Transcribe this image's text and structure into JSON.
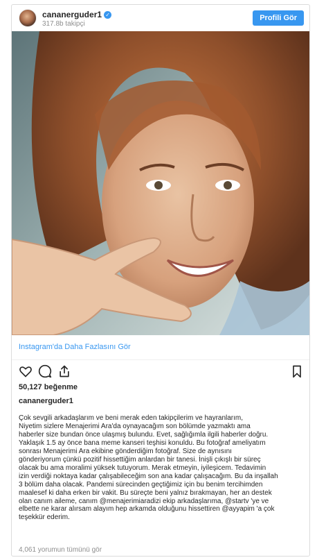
{
  "header": {
    "username": "cananerguder1",
    "verified_mark": "✓",
    "followers": "317.8b takipçi",
    "profile_button": "Profili Gör"
  },
  "post": {
    "image_icon": "photo-selfie",
    "more_link": "Instagram'da Daha Fazlasını Gör",
    "icons": [
      "heart-icon",
      "comment-icon",
      "share-icon",
      "bookmark-icon"
    ],
    "likes": "50,127 beğenme",
    "caption_username": "cananerguder1",
    "caption_lines": [
      "Çok sevgili arkadaşlarım ve beni merak eden takipçilerim ve hayranlarım,",
      "Niyetim sizlere Menajerimi Ara'da oynayacağım son bölümde yazmaktı ama",
      "haberler size bundan önce ulaşmış bulundu. Evet, sağlığımla ilgili haberler doğru.",
      "Yaklaşık 1.5 ay önce bana meme kanseri teşhisi konuldu. Bu fotoğraf ameliyatım",
      "sonrası Menajerimi Ara ekibine gönderdiğim fotoğraf. Size de aynısını",
      "gönderiyorum çünkü pozitif hissettiğim anlardan bir tanesi. İnişli çıkışlı bir süreç",
      "olacak bu ama moralimi yüksek tutuyorum. Merak etmeyin, iyileşicem. Tedavimin",
      "izin verdiği noktaya kadar çalışabileceğim son ana kadar çalışacağım. Bu da inşallah",
      "3 bölüm daha olacak. Pandemi sürecinden geçtiğimiz için bu benim tercihimden",
      "maalesef ki daha erken bir vakit. Bu süreçte beni yalnız bırakmayan, her an destek",
      "olan canım aileme, canım @menajerimiaradizi ekip arkadaşlarıma, @startv 'ye ve",
      "elbette ne karar alırsam alayım hep arkamda olduğunu hissettiren @ayyapim 'a çok",
      "teşekkür ederim."
    ],
    "comments_link": "4,061 yorumun tümünü gör"
  },
  "colors": {
    "accent": "#3897f0",
    "text": "#262626",
    "muted": "#8e8e8e",
    "border": "#dbdbdb"
  }
}
